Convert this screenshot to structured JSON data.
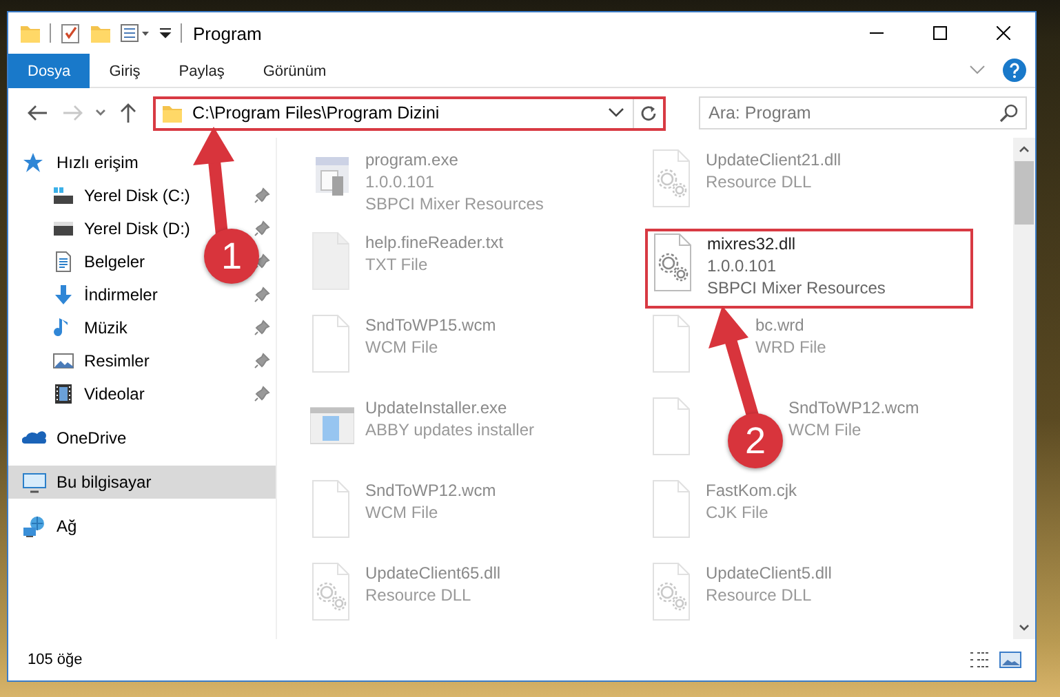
{
  "window": {
    "title": "Program"
  },
  "ribbon": {
    "tabs": [
      {
        "label": "Dosya",
        "selected": true
      },
      {
        "label": "Giriş",
        "selected": false
      },
      {
        "label": "Paylaş",
        "selected": false
      },
      {
        "label": "Görünüm",
        "selected": false
      }
    ]
  },
  "navigation": {
    "back": {
      "disabled": false
    },
    "forward": {
      "disabled": true
    }
  },
  "address": {
    "path": "C:\\Program Files\\Program Dizini",
    "highlighted": true
  },
  "search": {
    "placeholder": "Ara: Program"
  },
  "sidebar": {
    "items": [
      {
        "label": "Hızlı erişim",
        "selected": false,
        "children": [
          {
            "label": "Yerel Disk (C:)",
            "pinned": true,
            "selected": false
          },
          {
            "label": "Yerel Disk (D:)",
            "pinned": true,
            "selected": false
          },
          {
            "label": "Belgeler",
            "pinned": true,
            "selected": false
          },
          {
            "label": "İndirmeler",
            "pinned": true,
            "selected": false
          },
          {
            "label": "Müzik",
            "pinned": true,
            "selected": false
          },
          {
            "label": "Resimler",
            "pinned": true,
            "selected": false
          },
          {
            "label": "Videolar",
            "pinned": true,
            "selected": false
          }
        ]
      },
      {
        "label": "OneDrive",
        "selected": false
      },
      {
        "label": "Bu bilgisayar",
        "selected": true
      },
      {
        "label": "Ağ",
        "selected": false
      }
    ]
  },
  "files": [
    {
      "kind": "exe",
      "name": "program.exe",
      "details": [
        "1.0.0.101",
        "SBPCI Mixer Resources"
      ],
      "highlighted": false,
      "faded": true
    },
    {
      "kind": "dll",
      "name": "UpdateClient21.dll",
      "details": [
        "Resource DLL"
      ],
      "highlighted": false,
      "faded": true
    },
    {
      "kind": "text",
      "name": "help.fineReader.txt",
      "details": [
        "TXT File"
      ],
      "highlighted": false,
      "faded": true
    },
    {
      "kind": "dll",
      "name": "mixres32.dll",
      "details": [
        "1.0.0.101",
        "SBPCI Mixer Resources"
      ],
      "highlighted": true,
      "faded": false
    },
    {
      "kind": "blank",
      "name": "SndToWP15.wcm",
      "details": [
        "WCM File"
      ],
      "highlighted": false,
      "faded": true
    },
    {
      "kind": "blank",
      "name": "bc.wrd",
      "details": [
        "WRD File"
      ],
      "highlighted": false,
      "faded": true
    },
    {
      "kind": "installer",
      "name": "UpdateInstaller.exe",
      "details": [
        "ABBY updates installer"
      ],
      "highlighted": false,
      "faded": true
    },
    {
      "kind": "blank",
      "name": "SndToWP12.wcm",
      "details": [
        "WCM File"
      ],
      "highlighted": false,
      "faded": true
    },
    {
      "kind": "blank",
      "name": "SndToWP12.wcm",
      "details": [
        "WCM File"
      ],
      "highlighted": false,
      "faded": true
    },
    {
      "kind": "blank",
      "name": "FastKom.cjk",
      "details": [
        "CJK File"
      ],
      "highlighted": false,
      "faded": true
    },
    {
      "kind": "dll",
      "name": "UpdateClient65.dll",
      "details": [
        "Resource DLL"
      ],
      "highlighted": false,
      "faded": true
    },
    {
      "kind": "dll",
      "name": "UpdateClient5.dll",
      "details": [
        "Resource DLL"
      ],
      "highlighted": false,
      "faded": true
    }
  ],
  "callouts": [
    {
      "number": "1"
    },
    {
      "number": "2"
    }
  ],
  "status_bar": {
    "count": "105 öğe"
  }
}
